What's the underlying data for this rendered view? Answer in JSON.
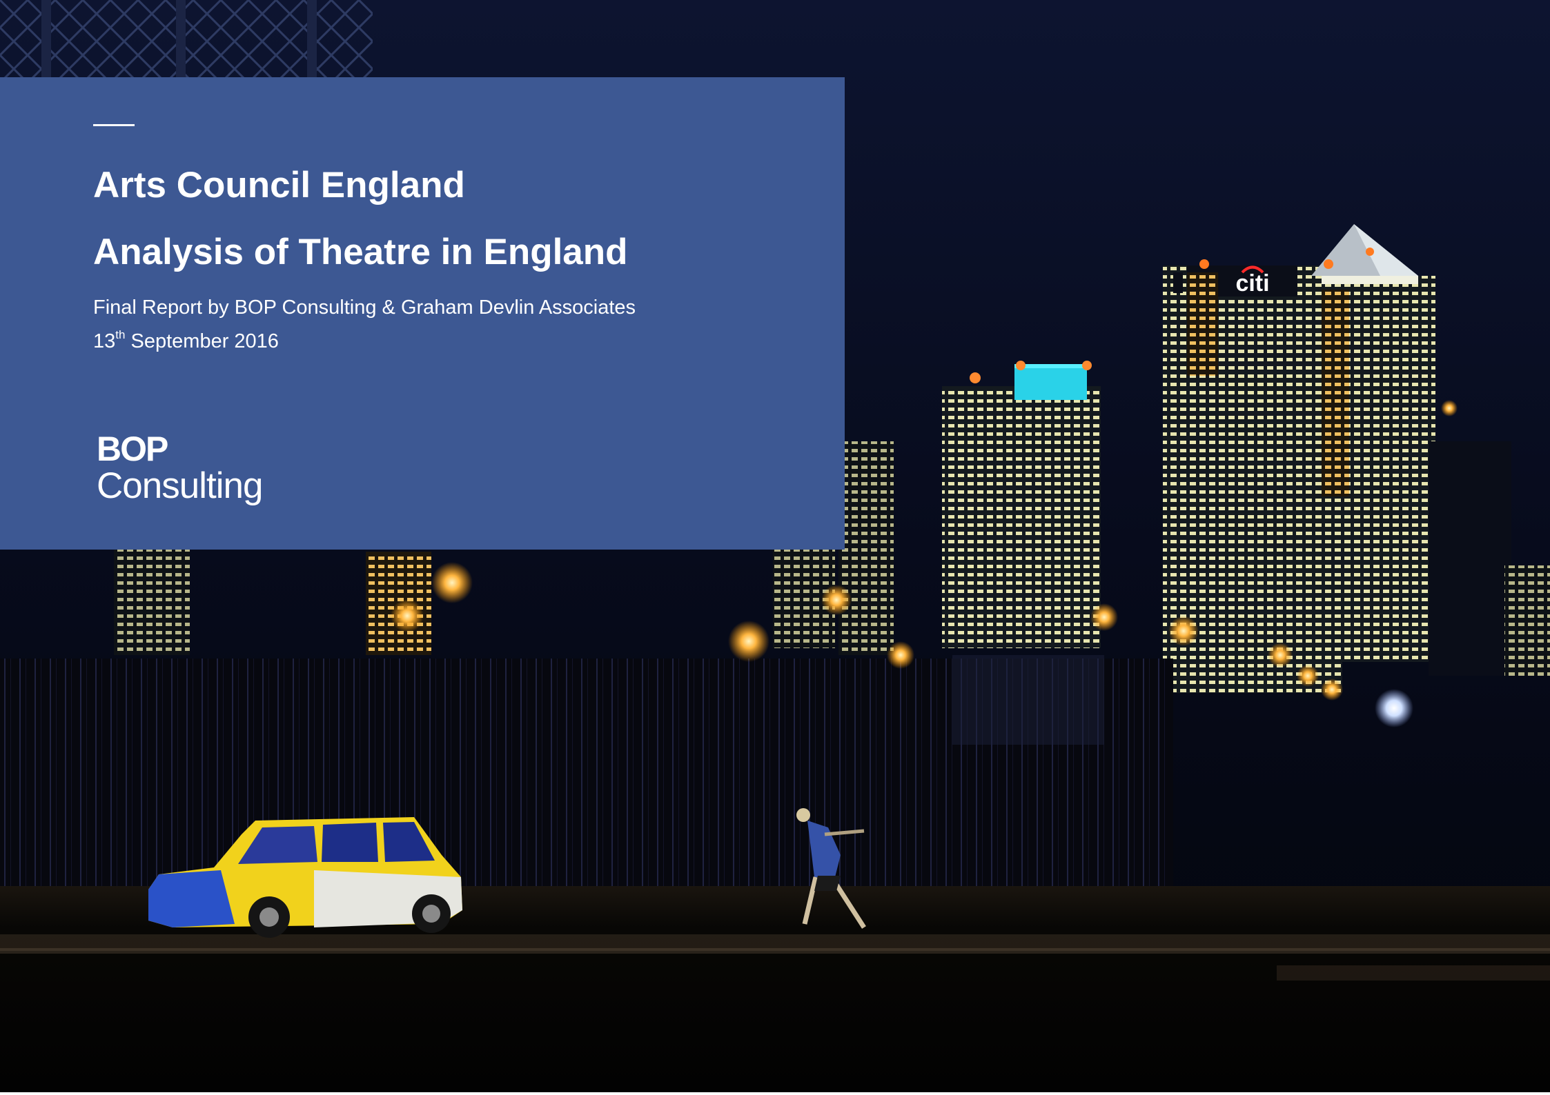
{
  "cover": {
    "title_line_1": "Arts Council England",
    "title_line_2": "Analysis of Theatre in England",
    "subtitle": "Final Report by BOP Consulting & Graham Devlin Associates",
    "date_day": "13",
    "date_suffix": "th",
    "date_rest": " September 2016"
  },
  "logo": {
    "line_1": "BOP",
    "line_2": "Consulting"
  },
  "photo": {
    "building_sign": "citi"
  },
  "colors": {
    "panel": "#3d5893",
    "text": "#ffffff",
    "night_sky": "#05070f"
  }
}
